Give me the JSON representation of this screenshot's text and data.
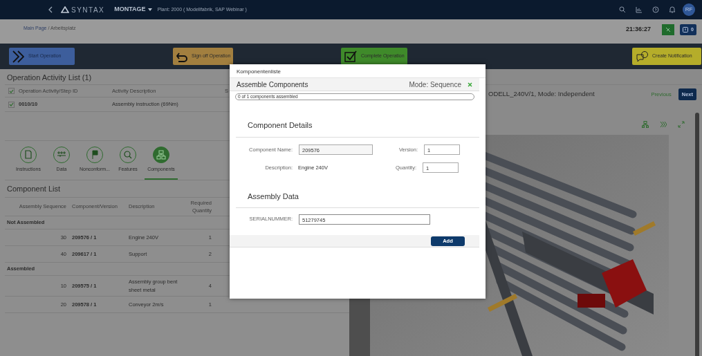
{
  "header": {
    "logo": "SYNTAX",
    "app": "MONTAGE",
    "plant": "Plant: 2000 ( Modellfabrik, SAP Webinar )",
    "avatar": "RF"
  },
  "subheader": {
    "breadcrumb_link": "Main Page",
    "breadcrumb_current": "/ Arbeitsplatz",
    "clock": "21:36:27",
    "message_count": "0"
  },
  "toolbar": [
    {
      "label": "Start Operation",
      "kind": "start"
    },
    {
      "label": "Sign off Operation",
      "kind": "signoff"
    },
    {
      "label": "Complete Operation",
      "kind": "complete"
    },
    {
      "label": "Create Notification",
      "kind": "notify"
    }
  ],
  "activity_list": {
    "title": "Operation Activity List (1)",
    "header_checked": true,
    "columns": [
      "Operation Activity/Step ID",
      "Activity Description",
      "S"
    ],
    "rows": [
      {
        "id": "0010/10",
        "description": "Assembly instruction (69Nm)",
        "checked": true
      }
    ]
  },
  "detail_tabs": [
    {
      "label": "Instructions",
      "kind": "document",
      "selected": false
    },
    {
      "label": "Data",
      "kind": "data",
      "selected": false
    },
    {
      "label": "Nonconform...",
      "kind": "flag",
      "selected": false
    },
    {
      "label": "Features",
      "kind": "search",
      "selected": false
    },
    {
      "label": "Components",
      "kind": "hierarchy",
      "selected": true
    }
  ],
  "component_list": {
    "title": "Component List",
    "columns": [
      "Assembly Sequence",
      "Component/Version",
      "Description",
      "Required Quantity"
    ],
    "groups": [
      {
        "title": "Not Assembled",
        "rows": [
          {
            "sequence": "30",
            "component": "209576 / 1",
            "description": "Engine 240V",
            "quantity": "1"
          },
          {
            "sequence": "40",
            "component": "209617 / 1",
            "description": "Support",
            "quantity": "2"
          }
        ]
      },
      {
        "title": "Assembled",
        "rows": [
          {
            "sequence": "10",
            "component": "209575 / 1",
            "description": "Assembly group bent sheet metal",
            "quantity": "4"
          },
          {
            "sequence": "20",
            "component": "209578 / 1",
            "description": "Conveyor 2m/s",
            "quantity": "1"
          }
        ]
      }
    ]
  },
  "viewer": {
    "title": "ODELL_240V/1, Mode: Independent",
    "previous": "Previous",
    "next": "Next"
  },
  "dialog": {
    "title": "Komponentenliste",
    "heading": "Assemble Components",
    "mode": "Mode: Sequence",
    "progress": {
      "label": "0 of 1 components assembled",
      "level": 0
    },
    "details_title": "Component Details",
    "component_name_label": "Component Name:",
    "component_name": "209576",
    "version_label": "Version:",
    "version": "1",
    "description_label": "Description:",
    "description": "Engine 240V",
    "quantity_label": "Quantity:",
    "quantity": "1",
    "assembly_title": "Assembly Data",
    "serial_label": "SERIALNUMMER:",
    "serial": "51279745",
    "add": "Add"
  }
}
